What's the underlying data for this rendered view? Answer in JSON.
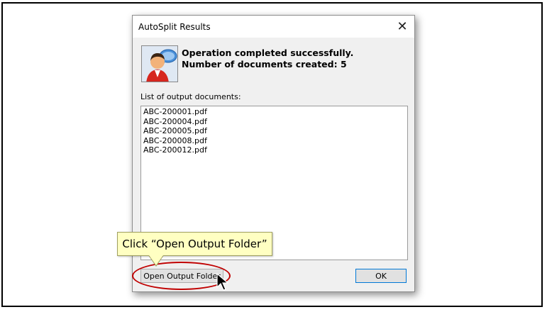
{
  "dialog": {
    "title": "AutoSplit Results",
    "close_glyph": "✕",
    "icon": "user-speech-icon",
    "message_line1": "Operation completed successfully.",
    "message_line2": "Number of documents created: 5",
    "list_label": "List of output documents:",
    "documents": [
      "ABC-200001.pdf",
      "ABC-200004.pdf",
      "ABC-200005.pdf",
      "ABC-200008.pdf",
      "ABC-200012.pdf"
    ],
    "open_folder_button": "Open Output Folder",
    "ok_button": "OK"
  },
  "annotation": {
    "callout_text": "Click “Open Output Folder”",
    "highlight_color": "#c00000",
    "callout_color": "#ffffc2"
  }
}
